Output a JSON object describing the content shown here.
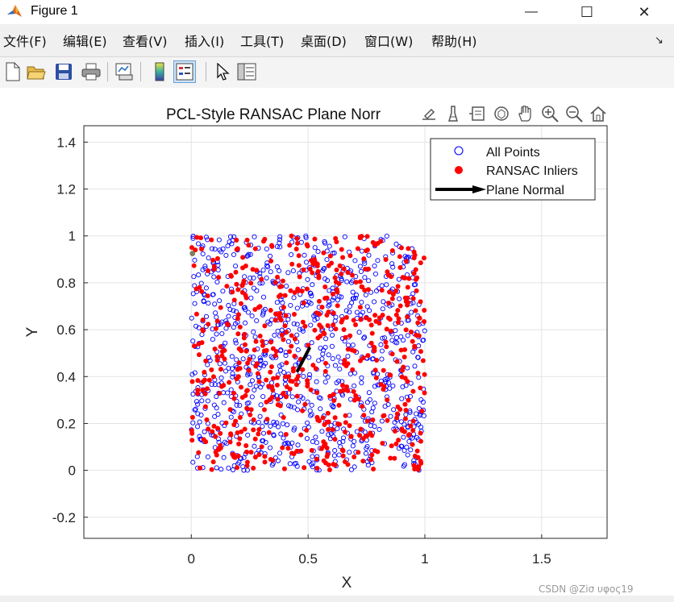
{
  "window": {
    "title": "Figure 1",
    "minimize_symbol": "—",
    "maximize_symbol": "☐",
    "close_symbol": "✕"
  },
  "menu": {
    "items": [
      "文件(F)",
      "编辑(E)",
      "查看(V)",
      "插入(I)",
      "工具(T)",
      "桌面(D)",
      "窗口(W)",
      "帮助(H)"
    ],
    "overflow_symbol": "↘"
  },
  "toolbar": {
    "buttons": [
      "new-figure-icon",
      "open-file-icon",
      "save-icon",
      "print-icon",
      "link-plot-icon",
      "colorbar-icon",
      "legend-icon",
      "pointer-icon",
      "property-editor-icon"
    ],
    "active": "legend-icon"
  },
  "axes_toolbar": {
    "buttons": [
      "export-icon",
      "brush-icon",
      "data-tips-icon",
      "rotate-3d-icon",
      "pan-hand-icon",
      "zoom-in-icon",
      "zoom-out-icon",
      "home-icon"
    ]
  },
  "watermark": "CSDN @Ζiσ υφος19",
  "colors": {
    "all_points": "#0000ff",
    "inliers": "#ff0000",
    "normal_arrow": "#000000",
    "grid": "#e3e3e3",
    "axes_border": "#262626",
    "legend_border": "#262626"
  },
  "chart_data": {
    "type": "scatter",
    "title": "PCL-Style RANSAC Plane Norr",
    "xlabel": "X",
    "ylabel": "Y",
    "xlim": [
      -0.46,
      1.78
    ],
    "ylim": [
      -0.29,
      1.47
    ],
    "xticks": [
      0,
      0.5,
      1,
      1.5
    ],
    "xtick_labels": [
      "0",
      "0.5",
      "1",
      "1.5"
    ],
    "yticks": [
      -0.2,
      0,
      0.2,
      0.4,
      0.6,
      0.8,
      1,
      1.2,
      1.4
    ],
    "ytick_labels": [
      "-0.2",
      "0",
      "0.2",
      "0.4",
      "0.6",
      "0.8",
      "1",
      "1.2",
      "1.4"
    ],
    "grid": true,
    "legend": {
      "location": "top-right",
      "entries": [
        "All Points",
        "RANSAC Inliers",
        "Plane Normal"
      ]
    },
    "series": [
      {
        "name": "All Points",
        "marker": "open-circle",
        "color": "#0000ff",
        "distribution": "uniform",
        "x_range": [
          0,
          1
        ],
        "y_range": [
          0,
          1
        ],
        "count": 900,
        "seed": 7
      },
      {
        "name": "RANSAC Inliers",
        "marker": "filled-circle",
        "color": "#ff0000",
        "distribution": "uniform",
        "x_range": [
          0,
          1
        ],
        "y_range": [
          0,
          1
        ],
        "count": 620,
        "seed": 13
      }
    ],
    "plane_normal": {
      "name": "Plane Normal",
      "from": [
        0.455,
        0.425
      ],
      "to": [
        0.505,
        0.52
      ],
      "color": "#000000"
    },
    "outlier_point": {
      "x": 0.005,
      "y": 0.925,
      "color": "#808060"
    }
  }
}
